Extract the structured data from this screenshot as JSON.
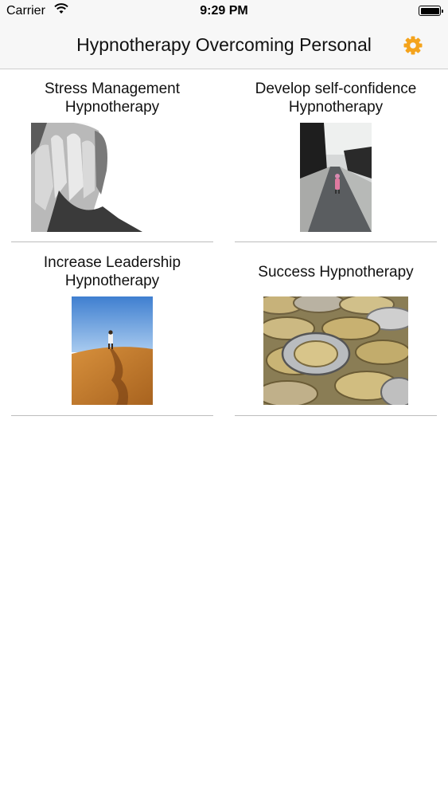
{
  "status_bar": {
    "carrier": "Carrier",
    "time": "9:29 PM"
  },
  "nav": {
    "title": "Hypnotherapy Overcoming Personal",
    "settings_icon": "gear-icon",
    "accent_color": "#f4a31c"
  },
  "categories": [
    {
      "title": "Stress Management\nHypnotherapy",
      "image": "man-covering-face-photo"
    },
    {
      "title": "Develop self-confidence\nHypnotherapy",
      "image": "child-on-road-photo"
    },
    {
      "title": "Increase Leadership\nHypnotherapy",
      "image": "desert-walker-photo"
    },
    {
      "title": "Success Hypnotherapy",
      "image": "coins-photo"
    }
  ]
}
